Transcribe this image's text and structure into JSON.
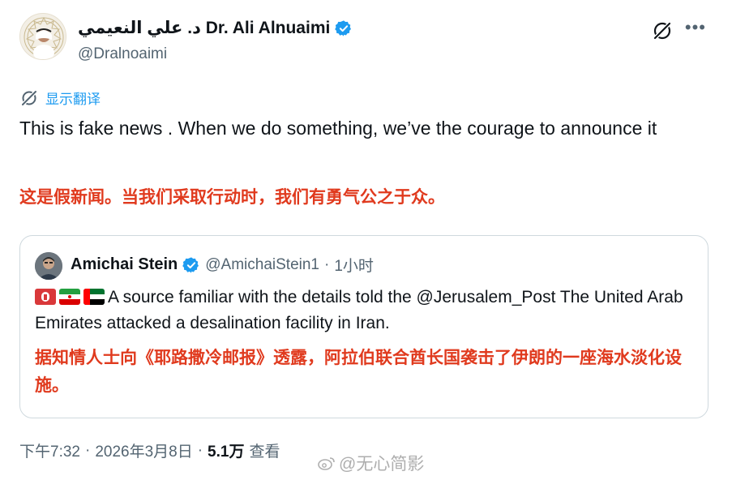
{
  "author": {
    "display_name": "د. علي النعيمي Dr. Ali Alnuaimi",
    "handle": "@Dralnoaimi"
  },
  "translate_label": "显示翻译",
  "tweet": {
    "text": "This is fake news . When we do something, we’ve the courage to announce it",
    "translation_cn": "这是假新闻。当我们采取行动时，我们有勇气公之于众。"
  },
  "quoted": {
    "name": "Amichai Stein",
    "handle": "@AmichaiStein1",
    "separator": "·",
    "time": "1小时",
    "text": "A source familiar with the details told the @Jerusalem_Post The United Arab Emirates attacked a desalination facility in Iran.",
    "translation_cn": "据知情人士向《耶路撒冷邮报》透露，阿拉伯联合酋长国袭击了伊朗的一座海水淡化设施。",
    "emoji_icons": [
      "siren-emoji",
      "iran-flag",
      "uae-flag"
    ]
  },
  "meta": {
    "time": "下午7:32",
    "sep1": "·",
    "date": "2026年3月8日",
    "sep2": "·",
    "views": "5.1万",
    "views_label": "查看"
  },
  "watermark": "@无心简影",
  "colors": {
    "accent": "#1d9bf0",
    "translation_red": "#e03a1e",
    "secondary_text": "#536471",
    "border": "#cfd9de"
  }
}
